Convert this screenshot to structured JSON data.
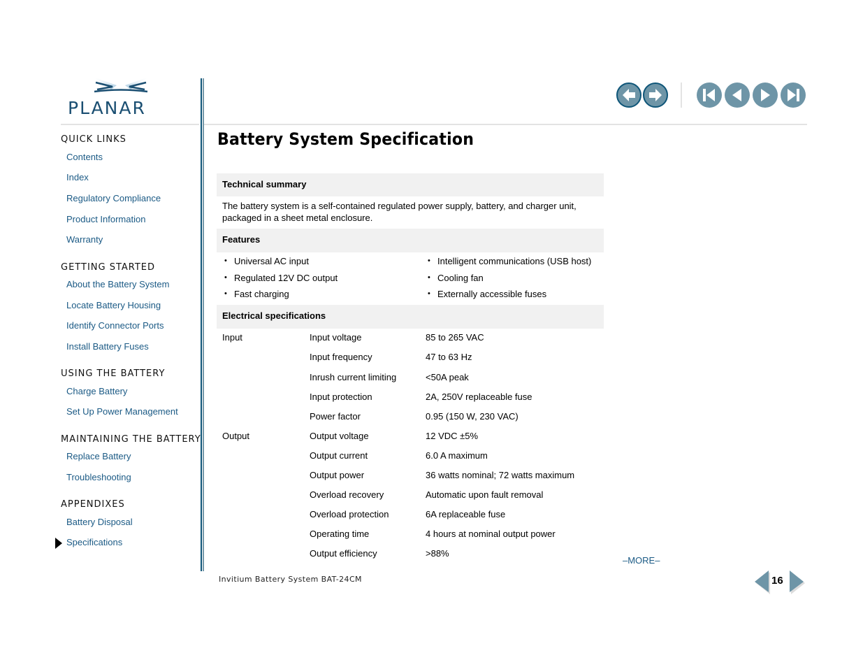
{
  "brand": {
    "logo_text": "PLANAR",
    "logo_color": "#1b4f72"
  },
  "toolbar": {
    "history_buttons": [
      {
        "name": "history-back",
        "icon": "arrow-left-icon"
      },
      {
        "name": "history-forward",
        "icon": "arrow-right-icon"
      }
    ],
    "page_buttons": [
      {
        "name": "first-page",
        "icon": "skip-first-icon"
      },
      {
        "name": "previous-page",
        "icon": "triangle-left-icon"
      },
      {
        "name": "next-page",
        "icon": "triangle-right-icon"
      },
      {
        "name": "last-page",
        "icon": "skip-last-icon"
      }
    ],
    "button_color": "#6e95a7"
  },
  "sidebar": {
    "sections": [
      {
        "heading": "QUICK LINKS",
        "items": [
          "Contents",
          "Index",
          "Regulatory Compliance",
          "Product Information",
          "Warranty"
        ]
      },
      {
        "heading": "GETTING STARTED",
        "items": [
          "About the Battery System",
          "Locate Battery Housing",
          "Identify Connector Ports",
          "Install Battery Fuses"
        ]
      },
      {
        "heading": "USING THE BATTERY",
        "items": [
          "Charge Battery",
          "Set Up Power Management"
        ]
      },
      {
        "heading": "MAINTAINING THE BATTERY",
        "items": [
          "Replace Battery",
          "Troubleshooting"
        ]
      },
      {
        "heading": "APPENDIXES",
        "items": [
          "Battery Disposal",
          "Specifications"
        ]
      }
    ],
    "current_item": "Specifications",
    "link_color": "#1b5a85"
  },
  "main": {
    "title": "Battery System Specification",
    "technical_summary": {
      "heading": "Technical summary",
      "text_line1": "The battery system is a self-contained regulated power supply, battery, and charger unit,",
      "text_line2": "packaged in a sheet metal enclosure."
    },
    "features": {
      "heading": "Features",
      "left": [
        "Universal AC input",
        "Regulated 12V DC output",
        "Fast charging"
      ],
      "right": [
        "Intelligent communications (USB host)",
        "Cooling fan",
        "Externally accessible fuses"
      ]
    },
    "electrical": {
      "heading": "Electrical specifications",
      "rows": [
        {
          "group": "Input",
          "param": "Input voltage",
          "value": "85 to 265 VAC"
        },
        {
          "group": "",
          "param": "Input frequency",
          "value": "47 to 63 Hz"
        },
        {
          "group": "",
          "param": "Inrush current limiting",
          "value": "<50A peak"
        },
        {
          "group": "",
          "param": "Input protection",
          "value": "2A, 250V replaceable fuse"
        },
        {
          "group": "",
          "param": "Power factor",
          "value": "0.95 (150 W, 230 VAC)"
        },
        {
          "group": "Output",
          "param": "Output voltage",
          "value": "12 VDC ±5%"
        },
        {
          "group": "",
          "param": "Output current",
          "value": "6.0 A maximum"
        },
        {
          "group": "",
          "param": "Output power",
          "value": "36 watts nominal; 72 watts maximum"
        },
        {
          "group": "",
          "param": "Overload recovery",
          "value": "Automatic upon fault removal"
        },
        {
          "group": "",
          "param": "Overload protection",
          "value": "6A replaceable fuse"
        },
        {
          "group": "",
          "param": "Operating time",
          "value": "4 hours at nominal output power"
        },
        {
          "group": "",
          "param": "Output efficiency",
          "value": ">88%"
        }
      ]
    },
    "more_label": "–MORE–"
  },
  "footer": {
    "document_name": "Invitium Battery System BAT-24CM",
    "page_number": "16"
  }
}
